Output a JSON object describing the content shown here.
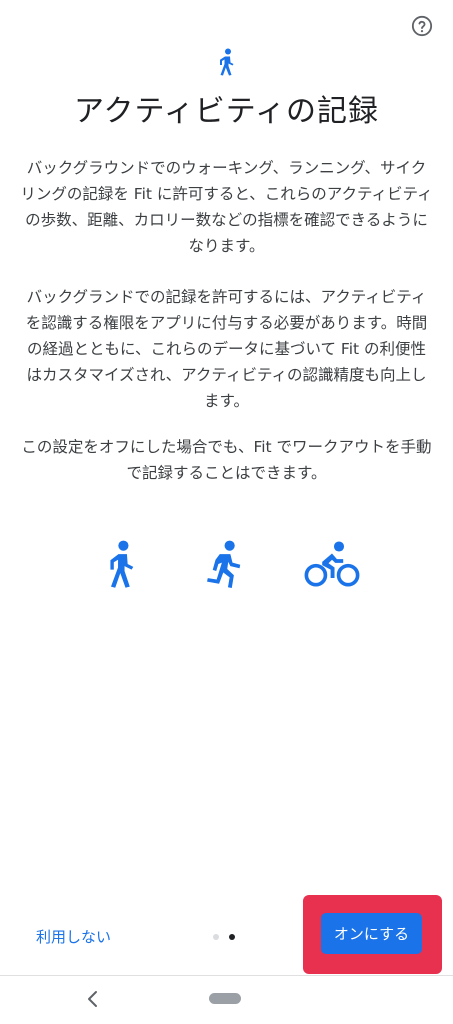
{
  "colors": {
    "accent": "#1a73e8",
    "icon_blue": "#1a73e8",
    "highlight": "#e8304f",
    "button_bg": "#1a73e8",
    "dot_active": "#202124",
    "dot_inactive": "#dadce0"
  },
  "header": {
    "help_icon": "help-circle-icon",
    "title_icon": "walking-icon",
    "title": "アクティビティの記録"
  },
  "body": {
    "paragraph1": "バックグラウンドでのウォーキング、ランニング、サイクリングの記録を Fit に許可すると、これらのアクティビティの歩数、距離、カロリー数などの指標を確認できるようになります。",
    "paragraph2": "バックグランドでの記録を許可するには、アクティビティを認識する権限をアプリに付与する必要があります。時間の経過とともに、これらのデータに基づいて Fit の利便性はカスタマイズされ、アクティビティの認識精度も向上します。",
    "paragraph3": "この設定をオフにした場合でも、Fit でワークアウトを手動で記録することはできます。"
  },
  "activities": [
    {
      "icon": "walking-icon"
    },
    {
      "icon": "running-icon"
    },
    {
      "icon": "cycling-icon"
    }
  ],
  "footer": {
    "skip_label": "利用しない",
    "turn_on_label": "オンにする",
    "page_count": 2,
    "current_page": 2
  },
  "nav": {
    "back_icon": "back-chevron-icon",
    "home_icon": "home-pill-icon"
  }
}
